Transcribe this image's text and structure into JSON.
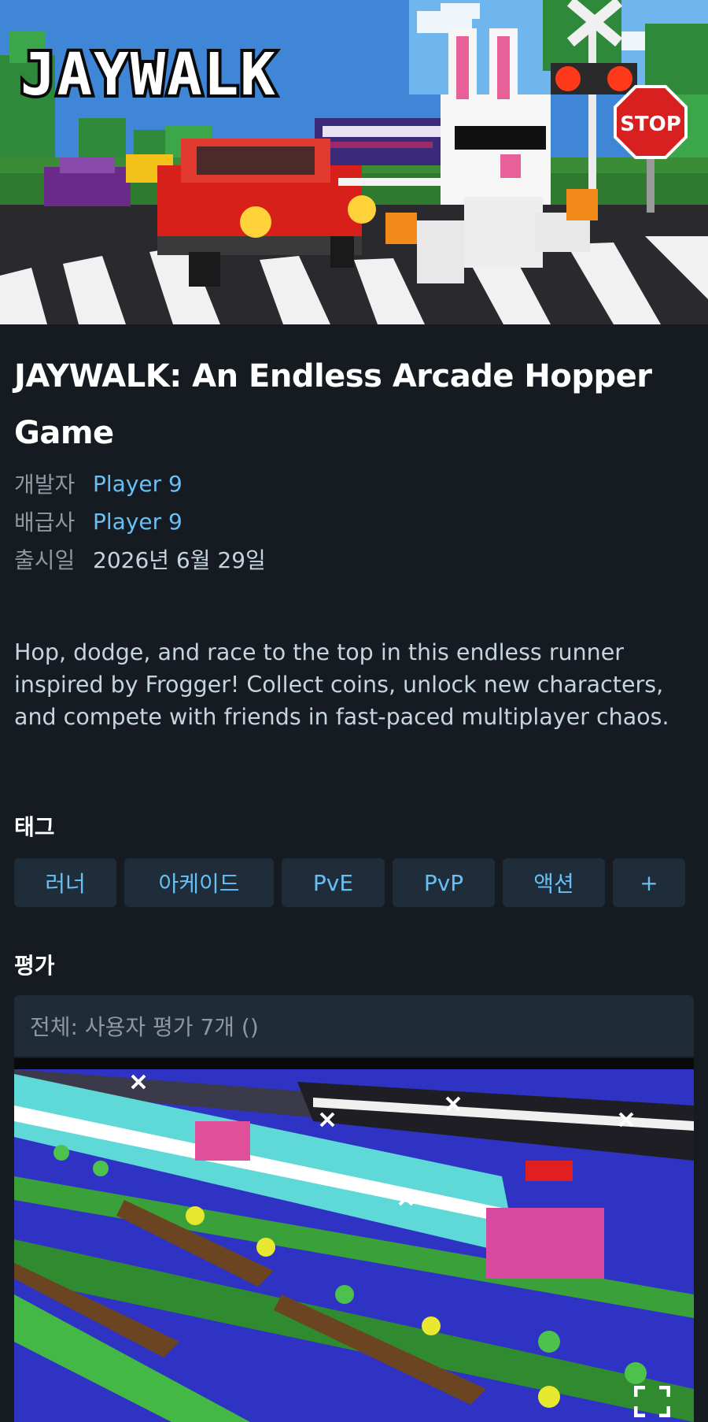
{
  "hero": {
    "logo_text": "JAYWALK",
    "stop_sign_text": "STOP"
  },
  "game": {
    "title": "JAYWALK: An Endless Arcade Hopper Game",
    "developer_label": "개발자",
    "developer": "Player 9",
    "publisher_label": "배급사",
    "publisher": "Player 9",
    "release_label": "출시일",
    "release_date": "2026년 6월 29일",
    "description": "Hop, dodge, and race to the top in this endless runner inspired by Frogger! Collect coins, unlock new characters, and compete with friends in fast-paced multiplayer chaos."
  },
  "tags": {
    "heading": "태그",
    "items": [
      "러너",
      "아케이드",
      "PvE",
      "PvP",
      "액션"
    ],
    "more_label": "+"
  },
  "reviews": {
    "heading": "평가",
    "summary": "전체: 사용자 평가 7개 ()"
  },
  "colors": {
    "background": "#161b22",
    "link": "#66c0f4",
    "muted": "#8f98a0",
    "tag_bg": "#1f2c3a"
  },
  "icons": {
    "expand": "expand-icon"
  }
}
